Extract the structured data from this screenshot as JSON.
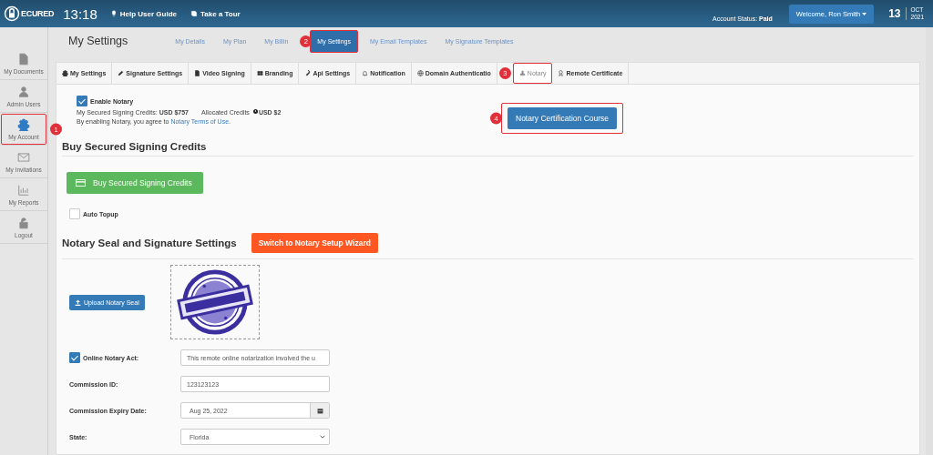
{
  "header": {
    "logo_text": "ECURED",
    "time": "13:18",
    "links": [
      {
        "label": "Help User Guide"
      },
      {
        "label": "Take a Tour"
      }
    ],
    "account_status_label": "Account Status:",
    "account_status": "Paid",
    "welcome": "Welcome,  Ron Smith",
    "date_day": "13",
    "date_month": "OCT",
    "date_year": "2021"
  },
  "sidebar": [
    {
      "label": "My Documents",
      "selected": false
    },
    {
      "label": "Admin Users",
      "selected": false
    },
    {
      "label": "My Account",
      "selected": true,
      "callout": "1"
    },
    {
      "label": "My Invitations",
      "selected": false
    },
    {
      "label": "My Reports",
      "selected": false
    },
    {
      "label": "Logout",
      "selected": false
    }
  ],
  "page_title": "My Settings",
  "nav": [
    {
      "label": "My Details",
      "selected": false
    },
    {
      "label": "My Plan",
      "selected": false
    },
    {
      "label": "My Billin",
      "selected": false
    },
    {
      "label": "My Settings",
      "selected": true,
      "callout": "2"
    },
    {
      "label": "My Email Templates",
      "selected": false
    },
    {
      "label": "My Signature Templates",
      "selected": false
    }
  ],
  "tabs": [
    {
      "label": "My Settings",
      "selected": false
    },
    {
      "label": "Signature Settings",
      "selected": false
    },
    {
      "label": "Video Signing",
      "selected": false
    },
    {
      "label": "Branding",
      "selected": false
    },
    {
      "label": "Api Settings",
      "selected": false
    },
    {
      "label": "Notification",
      "selected": false
    },
    {
      "label": "Domain Authenticatio",
      "selected": false
    },
    {
      "label": "Notary",
      "selected": true,
      "callout": "3"
    },
    {
      "label": "Remote Certificate",
      "selected": false
    }
  ],
  "notary": {
    "enable_label": "Enable Notary",
    "enabled": true,
    "credits_label": "My Secured Signing Credits:",
    "credits": "USD $757",
    "allocated_label": "Allocated Credits",
    "allocated": "USD $2",
    "terms_text": "By enabling Notary, you agree to",
    "terms_link": "Notary Terms of Use",
    "terms_end": ".",
    "course_button": "Notary Certification Course",
    "course_callout": "4"
  },
  "buy": {
    "heading": "Buy Secured Signing Credits",
    "button": "Buy Secured Signing Credits",
    "auto_topup_label": "Auto Topup",
    "auto_topup": false
  },
  "seal": {
    "heading": "Notary Seal and Signature Settings",
    "wizard_button": "Switch to Notary Setup Wizard",
    "upload_button": "Upload Notary Seal"
  },
  "form": [
    {
      "kind": "text",
      "label": "Online Notary Act:",
      "checked": true,
      "value": "This remote online notarization involved the u"
    },
    {
      "kind": "text",
      "label": "Commission ID:",
      "value": "123123123"
    },
    {
      "kind": "date",
      "label": "Commission Expiry Date:",
      "value": "Aug 25, 2022"
    },
    {
      "kind": "select",
      "label": "State:",
      "value": "Florida"
    }
  ]
}
